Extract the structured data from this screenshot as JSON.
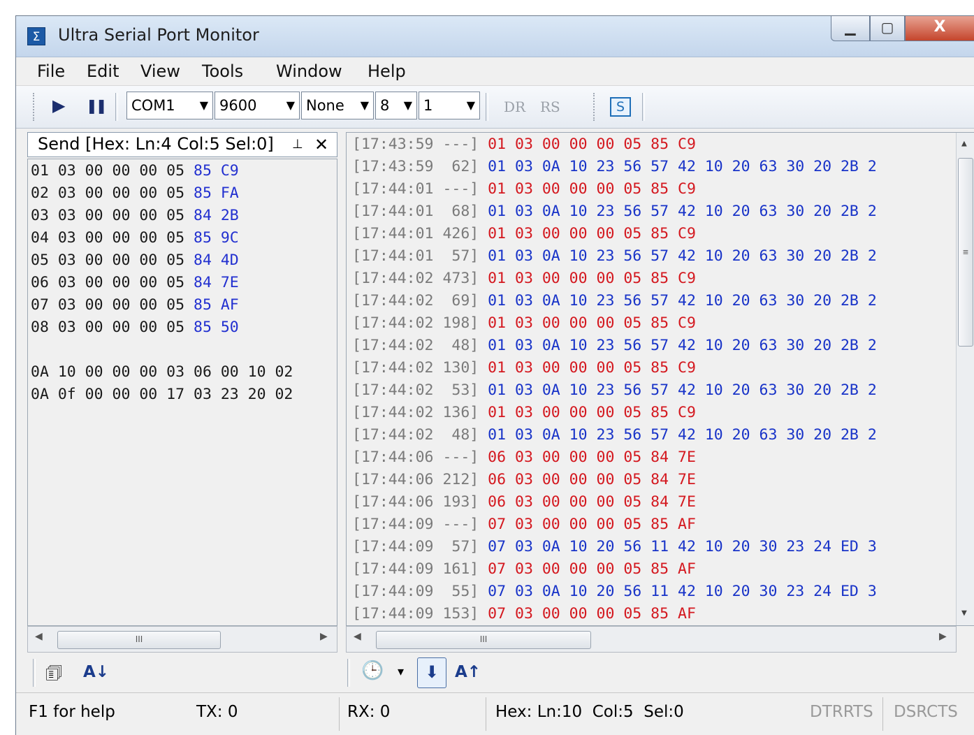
{
  "window": {
    "title": "Ultra Serial Port Monitor",
    "app_icon": "Σ",
    "minimize": "▁",
    "maximize": "▢",
    "close": "X"
  },
  "menu": [
    "File",
    "Edit",
    "View",
    "Tools",
    "Window",
    "Help"
  ],
  "toolbar": {
    "play_icon": "▶",
    "pause_icon": "❚❚",
    "port": "COM1",
    "baud": "9600",
    "parity": "None",
    "data_bits": "8",
    "stop_bits": "1",
    "dr_label": "DR",
    "rs_label": "RS",
    "s_label": "S"
  },
  "send_panel": {
    "header": "Send [Hex: Ln:4 Col:5 Sel:0]",
    "pin_icon": "⊥",
    "close_icon": "✕",
    "lines": [
      {
        "black": "01 03 00 00 00 05 ",
        "blue": "85 C9"
      },
      {
        "black": "02 03 00 00 00 05 ",
        "blue": "85 FA"
      },
      {
        "black": "03 03 00 00 00 05 ",
        "blue": "84 2B"
      },
      {
        "black": "04 03 00 00 00 05 ",
        "blue": "85 9C"
      },
      {
        "black": "05 03 00 00 00 05 ",
        "blue": "84 4D"
      },
      {
        "black": "06 03 00 00 00 05 ",
        "blue": "84 7E"
      },
      {
        "black": "07 03 00 00 00 05 ",
        "blue": "85 AF"
      },
      {
        "black": "08 03 00 00 00 05 ",
        "blue": "85 50"
      },
      {
        "black": "",
        "blue": ""
      },
      {
        "black": "0A 10 00 00 00 03 06 00 10 02",
        "blue": ""
      },
      {
        "black": "0A 0f 00 00 00 17 03 23 20 02",
        "blue": ""
      }
    ],
    "scroll_thumb": "III"
  },
  "log": [
    {
      "ts": "[17:43:59 ---]",
      "dir": "tx",
      "data": "01 03 00 00 00 05 85 C9"
    },
    {
      "ts": "[17:43:59  62]",
      "dir": "rx",
      "data": "01 03 0A 10 23 56 57 42 10 20 63 30 20 2B 2"
    },
    {
      "ts": "[17:44:01 ---]",
      "dir": "tx",
      "data": "01 03 00 00 00 05 85 C9"
    },
    {
      "ts": "[17:44:01  68]",
      "dir": "rx",
      "data": "01 03 0A 10 23 56 57 42 10 20 63 30 20 2B 2"
    },
    {
      "ts": "[17:44:01 426]",
      "dir": "tx",
      "data": "01 03 00 00 00 05 85 C9"
    },
    {
      "ts": "[17:44:01  57]",
      "dir": "rx",
      "data": "01 03 0A 10 23 56 57 42 10 20 63 30 20 2B 2"
    },
    {
      "ts": "[17:44:02 473]",
      "dir": "tx",
      "data": "01 03 00 00 00 05 85 C9"
    },
    {
      "ts": "[17:44:02  69]",
      "dir": "rx",
      "data": "01 03 0A 10 23 56 57 42 10 20 63 30 20 2B 2"
    },
    {
      "ts": "[17:44:02 198]",
      "dir": "tx",
      "data": "01 03 00 00 00 05 85 C9"
    },
    {
      "ts": "[17:44:02  48]",
      "dir": "rx",
      "data": "01 03 0A 10 23 56 57 42 10 20 63 30 20 2B 2"
    },
    {
      "ts": "[17:44:02 130]",
      "dir": "tx",
      "data": "01 03 00 00 00 05 85 C9"
    },
    {
      "ts": "[17:44:02  53]",
      "dir": "rx",
      "data": "01 03 0A 10 23 56 57 42 10 20 63 30 20 2B 2"
    },
    {
      "ts": "[17:44:02 136]",
      "dir": "tx",
      "data": "01 03 00 00 00 05 85 C9"
    },
    {
      "ts": "[17:44:02  48]",
      "dir": "rx",
      "data": "01 03 0A 10 23 56 57 42 10 20 63 30 20 2B 2"
    },
    {
      "ts": "[17:44:06 ---]",
      "dir": "tx",
      "data": "06 03 00 00 00 05 84 7E"
    },
    {
      "ts": "[17:44:06 212]",
      "dir": "tx",
      "data": "06 03 00 00 00 05 84 7E"
    },
    {
      "ts": "[17:44:06 193]",
      "dir": "tx",
      "data": "06 03 00 00 00 05 84 7E"
    },
    {
      "ts": "[17:44:09 ---]",
      "dir": "tx",
      "data": "07 03 00 00 00 05 85 AF"
    },
    {
      "ts": "[17:44:09  57]",
      "dir": "rx",
      "data": "07 03 0A 10 20 56 11 42 10 20 30 23 24 ED 3"
    },
    {
      "ts": "[17:44:09 161]",
      "dir": "tx",
      "data": "07 03 00 00 00 05 85 AF"
    },
    {
      "ts": "[17:44:09  55]",
      "dir": "rx",
      "data": "07 03 0A 10 20 56 11 42 10 20 30 23 24 ED 3"
    },
    {
      "ts": "[17:44:09 153]",
      "dir": "tx",
      "data": "07 03 00 00 00 05 85 AF"
    }
  ],
  "log_scroll": {
    "h_thumb": "III",
    "v_thumb": "≡"
  },
  "bottom_left": {
    "properties_icon": "🗊",
    "sort_label": "A↓"
  },
  "bottom_right": {
    "clock_icon": "🕒",
    "dropdown": "▾",
    "down_arrow": "⬇",
    "sort_label": "A↑"
  },
  "status": {
    "help": "F1 for help",
    "tx": "TX: 0",
    "rx": "RX: 0",
    "pos": "Hex: Ln:10  Col:5  Sel:0",
    "dtr_rts": "DTRRTS",
    "dsr_cts": "DSRCTS"
  }
}
